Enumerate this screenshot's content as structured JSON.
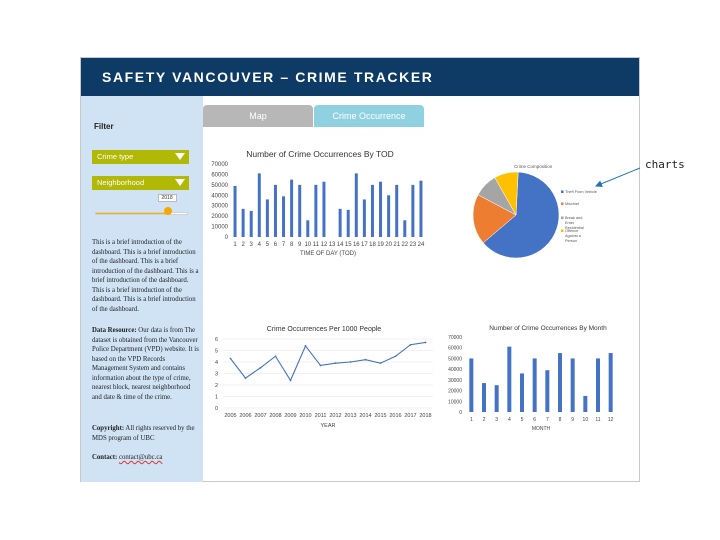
{
  "header": {
    "title": "SAFETY VANCOUVER – CRIME TRACKER"
  },
  "sidebar": {
    "filter_label": "Filter",
    "dropdown_crime_type": "Crime type",
    "dropdown_neighborhood": "Neighborhood",
    "slider": {
      "value_label": "2018",
      "position": 0.78
    },
    "intro": "This is a brief introduction of the dashboard. This is a brief introduction of the dashboard. This is a brief introduction of the dashboard. This is a brief introduction of the dashboard. This is a brief introduction of the dashboard. This is a brief introduction of the dashboard.",
    "data_resource_label": "Data Resource:",
    "data_resource_text": " Our data is from The dataset is obtained from the Vancouver Police Department (VPD) website. It is based on the VPD Records Management System and contains information about the type of crime, nearest block, nearest neighborhood and date & time of the crime.",
    "copyright_label": "Copyright:",
    "copyright_text": " All rights reserved by the MDS program of UBC",
    "contact_label": "Contact:",
    "contact_link": "contact@ubc.ca"
  },
  "tabs": {
    "map": "Map",
    "crime_occurrence": "Crime Occurrence"
  },
  "annotation": {
    "label": "charts"
  },
  "colors": {
    "header": "#0e3a66",
    "sidebar": "#cfe3f4",
    "dropdown": "#b1b805",
    "bar": "#4472c4",
    "tab_active": "#8fd1e0",
    "tab_inactive": "#b7b7b7"
  },
  "chart_data": [
    {
      "type": "bar",
      "title": "Number of Crime Occurrences By TOD",
      "xlabel": "TIME OF DAY (TOD)",
      "ylabel": "",
      "ylim": [
        0,
        70000
      ],
      "yticks": [
        0,
        10000,
        20000,
        30000,
        40000,
        50000,
        60000,
        70000
      ],
      "categories": [
        "1",
        "2",
        "3",
        "4",
        "5",
        "6",
        "7",
        "8",
        "9",
        "10",
        "11",
        "12",
        "13",
        "14",
        "15",
        "16",
        "17",
        "18",
        "19",
        "20",
        "21",
        "22",
        "23",
        "24"
      ],
      "values": [
        49000,
        27000,
        25000,
        61000,
        36000,
        50000,
        39000,
        55000,
        50000,
        16000,
        50000,
        53000,
        0,
        27000,
        26000,
        61000,
        36000,
        50000,
        53000,
        40000,
        50000,
        16000,
        50000,
        54000
      ]
    },
    {
      "type": "pie",
      "title": "Crime Composition",
      "labels": [
        "Theft From Vehicle",
        "Mischief",
        "Break and Enter Residential",
        "Offence Against a Person"
      ],
      "values": [
        63,
        19,
        9,
        9
      ],
      "colors": [
        "#4472c4",
        "#ed7d31",
        "#a5a5a5",
        "#ffc000"
      ]
    },
    {
      "type": "line",
      "title": "Crime Occurrences Per 1000 People",
      "xlabel": "YEAR",
      "ylabel": "",
      "ylim": [
        0,
        6
      ],
      "yticks": [
        0,
        1,
        2,
        3,
        4,
        5,
        6
      ],
      "x": [
        "2005",
        "2006",
        "2007",
        "2008",
        "2009",
        "2010",
        "2011",
        "2012",
        "2013",
        "2014",
        "2015",
        "2016",
        "2017",
        "2018"
      ],
      "values": [
        4.3,
        2.6,
        3.5,
        4.5,
        2.4,
        5.4,
        3.7,
        3.9,
        4.0,
        4.2,
        3.9,
        4.5,
        5.5,
        5.7
      ]
    },
    {
      "type": "bar",
      "title": "Number of Crime Occurrences By Month",
      "xlabel": "MONTH",
      "ylabel": "",
      "ylim": [
        0,
        70000
      ],
      "yticks": [
        0,
        10000,
        20000,
        30000,
        40000,
        50000,
        60000,
        70000
      ],
      "categories": [
        "1",
        "2",
        "3",
        "4",
        "5",
        "6",
        "7",
        "8",
        "9",
        "10",
        "11",
        "12"
      ],
      "values": [
        50000,
        27000,
        25000,
        61000,
        36000,
        50000,
        39000,
        55000,
        50000,
        15000,
        50000,
        55000
      ]
    }
  ]
}
